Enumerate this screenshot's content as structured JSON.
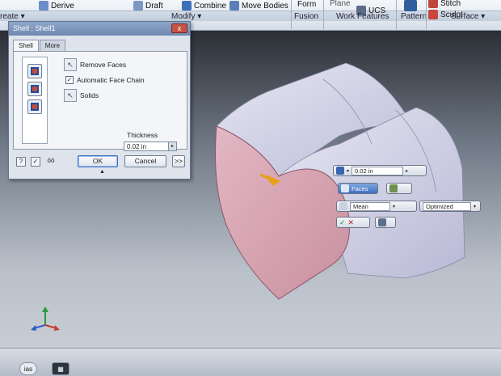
{
  "ribbon": {
    "partial_left_top": "Derive",
    "create_label": "reate ▾",
    "draft_label": "Draft",
    "combine_label": "Combine",
    "move_bodies_label": "Move Bodies",
    "edit_form_label": "Edit\nForm",
    "plane_label": "Plane",
    "ucs_label": "UCS",
    "stitch_label": "Stitch",
    "sculpt_label": "Sculpt",
    "panels": {
      "modify": "Modify ▾",
      "fusion": "Fusion",
      "work_features": "Work Features",
      "pattern": "Pattern",
      "surface": "Surface ▾"
    }
  },
  "dialog": {
    "title": "Shell : Shell1",
    "close": "x",
    "tabs": [
      "Shell",
      "More"
    ],
    "remove_faces_label": "Remove Faces",
    "automatic_face_chain_label": "Automatic Face Chain",
    "automatic_face_chain_checked": true,
    "solids_label": "Solids",
    "thickness_label": "Thickness",
    "thickness_value": "0.02 in",
    "ok_label": "OK",
    "cancel_label": "Cancel",
    "more_label": ">>",
    "help_label": "?",
    "preview_checked": true,
    "glasses_label": "óó"
  },
  "mini_toolbar": {
    "thickness_value": "0.02 in",
    "faces_label": "Faces",
    "mean_label": "Mean",
    "optimized_label": "Optimized",
    "apply_label": "✓",
    "cancel_label": "✕"
  },
  "statusbar": {
    "left_button": "ias"
  },
  "colors": {
    "shell_face_pink": "#d8a4b4",
    "shell_face_top": "#c9c9e0",
    "arrow_orange": "#e8a01c"
  }
}
